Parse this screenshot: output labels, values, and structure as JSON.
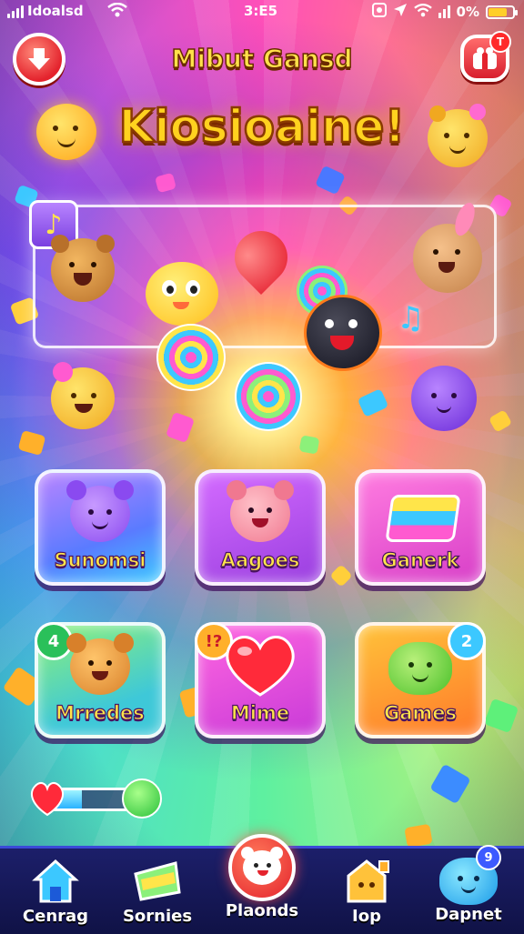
{
  "status_bar": {
    "carrier": "Idoalsd",
    "time": "3:E5",
    "battery_text": "0%"
  },
  "header": {
    "subtitle": "Mibut Gansd",
    "title": "Kiosioaine!",
    "shop_badge": "T"
  },
  "tiles": [
    {
      "label": "Sunomsi",
      "icon": "purple-bear-icon"
    },
    {
      "label": "Aagoes",
      "icon": "pink-bear-icon"
    },
    {
      "label": "Ganerk",
      "icon": "candy-block-icon"
    },
    {
      "label": "Mrredes",
      "icon": "orange-bear-icon",
      "badge": "4"
    },
    {
      "label": "Mime",
      "icon": "heart-icon",
      "badge": "!?"
    },
    {
      "label": "Games",
      "icon": "green-blob-icon",
      "badge": "2"
    }
  ],
  "progress": {
    "value": 0.35
  },
  "nav": [
    {
      "label": "Cenrag",
      "icon": "home-icon"
    },
    {
      "label": "Sornies",
      "icon": "candy-wedge-icon"
    },
    {
      "label": "Plaonds",
      "icon": "red-bear-face-icon"
    },
    {
      "label": "Iop",
      "icon": "house-box-icon"
    },
    {
      "label": "Dapnet",
      "icon": "blue-blob-icon",
      "badge": "9"
    }
  ],
  "colors": {
    "title_yellow": "#ffd21f",
    "label_yellow": "#ffe54a",
    "nav_bg": "#1c1f6a",
    "accent_red": "#e4232d"
  }
}
